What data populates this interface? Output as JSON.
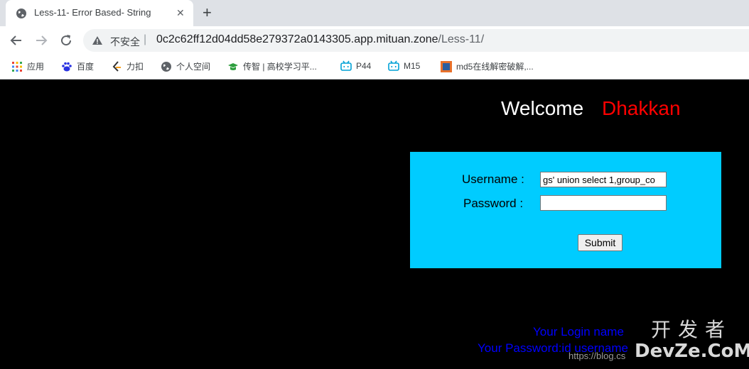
{
  "browser": {
    "tab_title": "Less-11- Error Based- String",
    "tab_close": "✕",
    "new_tab": "+",
    "insecure_label": "不安全",
    "url_separator": "|",
    "url_host": "0c2c62ff12d04dd58e279372a0143305.app.mituan.zone",
    "url_path": "/Less-11/"
  },
  "bookmarks": [
    {
      "label": "应用",
      "icon": "apps-grid-icon"
    },
    {
      "label": "百度",
      "icon": "baidu-paw-icon"
    },
    {
      "label": "力扣",
      "icon": "leetcode-icon"
    },
    {
      "label": "个人空间",
      "icon": "globe-icon"
    },
    {
      "label": "传智 | 高校学习平...",
      "icon": "graduation-cap-icon"
    },
    {
      "label": "P44",
      "icon": "bilibili-icon"
    },
    {
      "label": "M15",
      "icon": "bilibili-icon"
    },
    {
      "label": "md5在线解密破解,...",
      "icon": "cmd5-icon"
    }
  ],
  "page": {
    "welcome": "Welcome",
    "user": "Dhakkan",
    "username_label": "Username :",
    "password_label": "Password :",
    "username_value": "gs' union select 1,group_co",
    "password_value": "",
    "submit_label": "Submit",
    "result_login": "Your Login name",
    "result_password": "Your Password:id username"
  },
  "overlays": {
    "footer_url": "https://blog.cs",
    "watermark_line1": "开发者",
    "watermark_line2": "DevZe.CoM"
  },
  "colors": {
    "page_bg": "#000000",
    "welcome_name": "#ff0000",
    "login_box": "#00ccff",
    "result_text": "#0000ff"
  }
}
